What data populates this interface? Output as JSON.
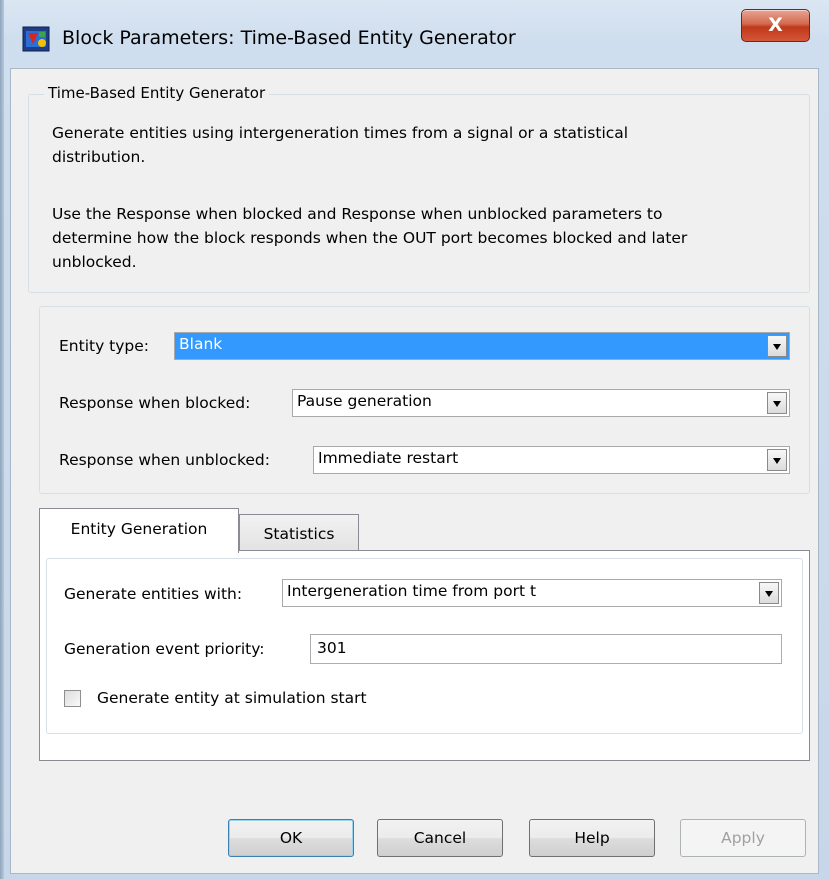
{
  "window": {
    "title": "Block Parameters: Time-Based Entity Generator",
    "close_label": "X"
  },
  "description": {
    "group_title": "Time-Based Entity Generator",
    "paragraph1": [
      "Generate entities using intergeneration times from a signal or a statistical",
      "distribution."
    ],
    "paragraph2": [
      "Use the Response when blocked and Response when unblocked parameters to",
      "determine how the block responds when the OUT port becomes blocked and later",
      "unblocked."
    ]
  },
  "parameters": {
    "entity_type": {
      "label": "Entity type:",
      "value": "Blank"
    },
    "response_blocked": {
      "label": "Response when blocked:",
      "value": "Pause generation"
    },
    "response_unblocked": {
      "label": "Response when unblocked:",
      "value": "Immediate restart"
    }
  },
  "tabs": [
    {
      "label": "Entity Generation",
      "active": true
    },
    {
      "label": "Statistics",
      "active": false
    }
  ],
  "entity_generation": {
    "generate_with": {
      "label": "Generate entities with:",
      "value": "Intergeneration time from port t"
    },
    "priority": {
      "label": "Generation event priority:",
      "value": "301"
    },
    "start_checkbox": {
      "label": "Generate entity at simulation start",
      "checked": false
    }
  },
  "buttons": {
    "ok": "OK",
    "cancel": "Cancel",
    "help": "Help",
    "apply": "Apply"
  },
  "colors": {
    "selection": "#3399ff",
    "close_button": "#c0391b"
  }
}
